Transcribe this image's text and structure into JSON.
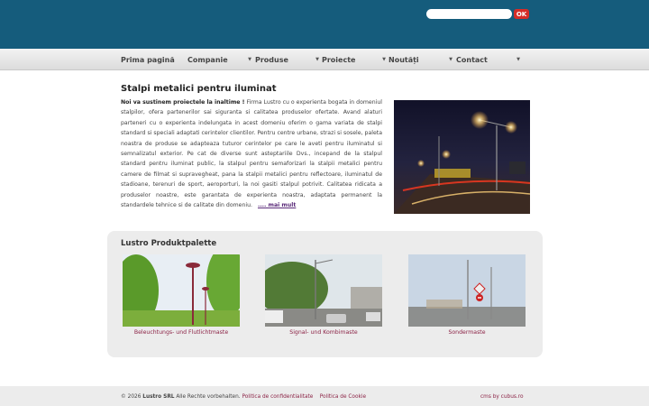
{
  "search": {
    "placeholder": "",
    "button_label": "OK"
  },
  "nav": {
    "items": [
      {
        "label": "Prima pagină",
        "dropdown": false
      },
      {
        "label": "Companie",
        "dropdown": true
      },
      {
        "label": "Produse",
        "dropdown": true
      },
      {
        "label": "Proiecte",
        "dropdown": true
      },
      {
        "label": "Noutăți",
        "dropdown": true
      },
      {
        "label": "Contact",
        "dropdown": true
      }
    ],
    "dropdown_icon": "chevron-down-icon"
  },
  "intro": {
    "title": "Stalpi metalici pentru iluminat",
    "lead": "Noi va sustinem proiectele la inaltime !",
    "body": "Firma Lustro cu o experienta bogata in domeniul stalpilor, ofera partenerilor sai siguranta si calitatea produselor ofertate. Avand alaturi parteneri cu o experienta indelungata in acest domeniu oferim o gama variata de stalpi standard si speciali adaptati cerintelor clientilor. Pentru centre urbane, strazi si sosele, paleta noastra de produse se adapteaza tuturor cerintelor pe care le aveti pentru iluminatul si semnalizatul exterior. Pe cat de diverse sunt asteptariile Dvs., incepand de la stalpul standard pentru iluminat public, la stalpul pentru semaforizari la stalpii metalici pentru camere de filmat si supravegheat, pana la stalpii metalici pentru reflectoare, iluminatul de stadioane, terenuri de sport, aeroporturi, la noi gasiti stalpul potrivit. Calitatea ridicata a produselor noastre, este garantata de experienta noastra, adaptata permanent la standardele tehnice si de calitate din domeniu.",
    "more_label": ".... mai mult"
  },
  "palette": {
    "title": "Lustro Produktpalette",
    "products": [
      {
        "caption": "Beleuchtungs- und Flutlichtmaste"
      },
      {
        "caption": "Signal- und Kombimaste"
      },
      {
        "caption": "Sondermaste"
      }
    ]
  },
  "footer": {
    "copyright_prefix": "© 2026",
    "company": "Lustro SRL",
    "rights": "Alle Rechte vorbehalten.",
    "privacy_label": "Politica de confidentialitate",
    "cookie_label": "Politica de Cookie",
    "cms_label": "cms by cubus.ro"
  },
  "colors": {
    "header": "#155c7c",
    "accent_red": "#d62d28",
    "link": "#8b2245",
    "more_link": "#5b2b7a"
  }
}
